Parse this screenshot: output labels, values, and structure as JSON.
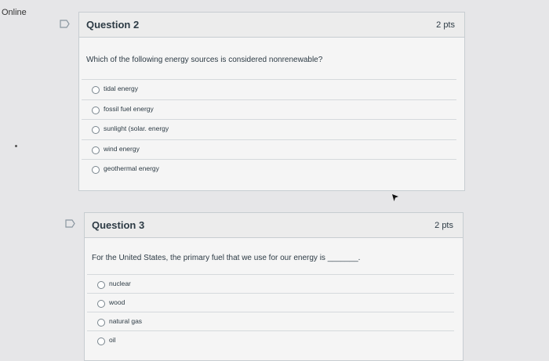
{
  "status": {
    "label": "Online"
  },
  "questions": [
    {
      "title": "Question 2",
      "points": "2 pts",
      "text": "Which of the following energy sources is considered nonrenewable?",
      "answers": [
        "tidal energy",
        "fossil fuel energy",
        "sunlight (solar. energy",
        "wind energy",
        "geothermal energy"
      ]
    },
    {
      "title": "Question 3",
      "points": "2 pts",
      "text": "For the United States, the primary fuel that we use for our energy is _______.",
      "answers": [
        "nuclear",
        "wood",
        "natural gas",
        "oil"
      ]
    }
  ],
  "icons": {
    "flag": "flag-icon",
    "cursor": "mouse-pointer-icon"
  },
  "colors": {
    "header": "#ececec",
    "body": "#f5f5f5",
    "border": "#c7cdd1",
    "text": "#2d3b45"
  }
}
